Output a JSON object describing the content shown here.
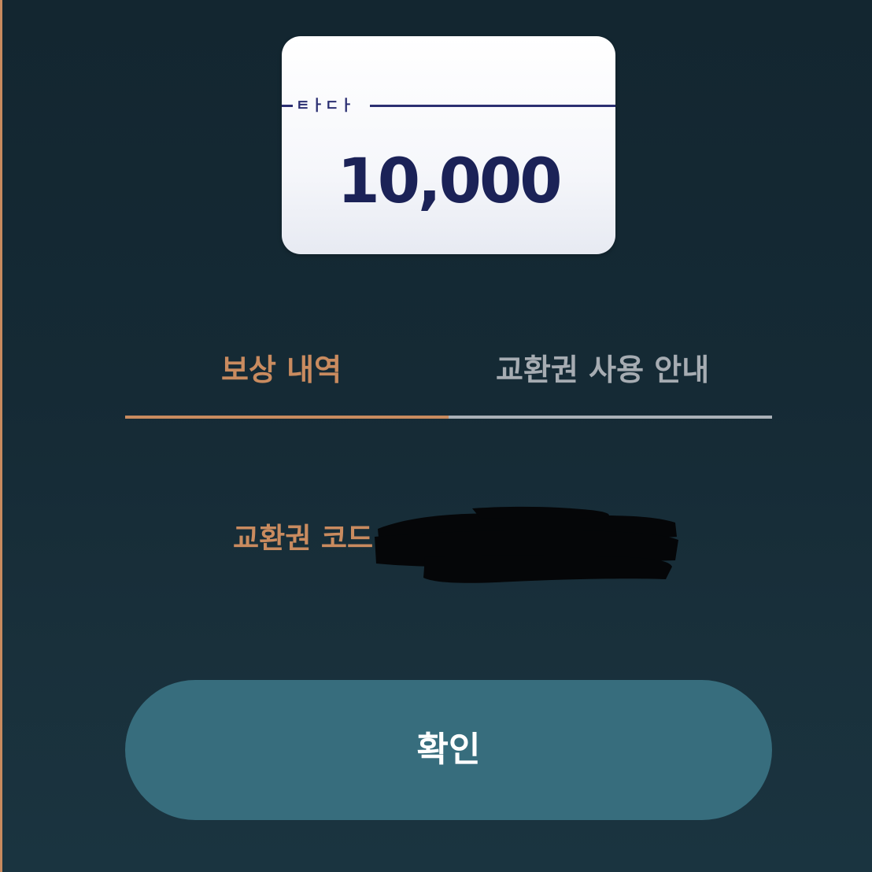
{
  "voucher": {
    "brand": "ㅌㅏㄷㅏ",
    "amount": "10,000",
    "colors": {
      "card_text": "#1b2257",
      "brand_line": "#2b2f72"
    }
  },
  "tabs": [
    {
      "label": "보상 내역",
      "active": true
    },
    {
      "label": "교환권 사용 안내",
      "active": false
    }
  ],
  "code": {
    "label": "교환권 코드",
    "value_redacted": true
  },
  "confirm": {
    "label": "확인"
  },
  "theme": {
    "accent": "#c98b5f",
    "button": "#376d7d",
    "background": "#152a35",
    "inactive_tab": "#a6acb2"
  }
}
